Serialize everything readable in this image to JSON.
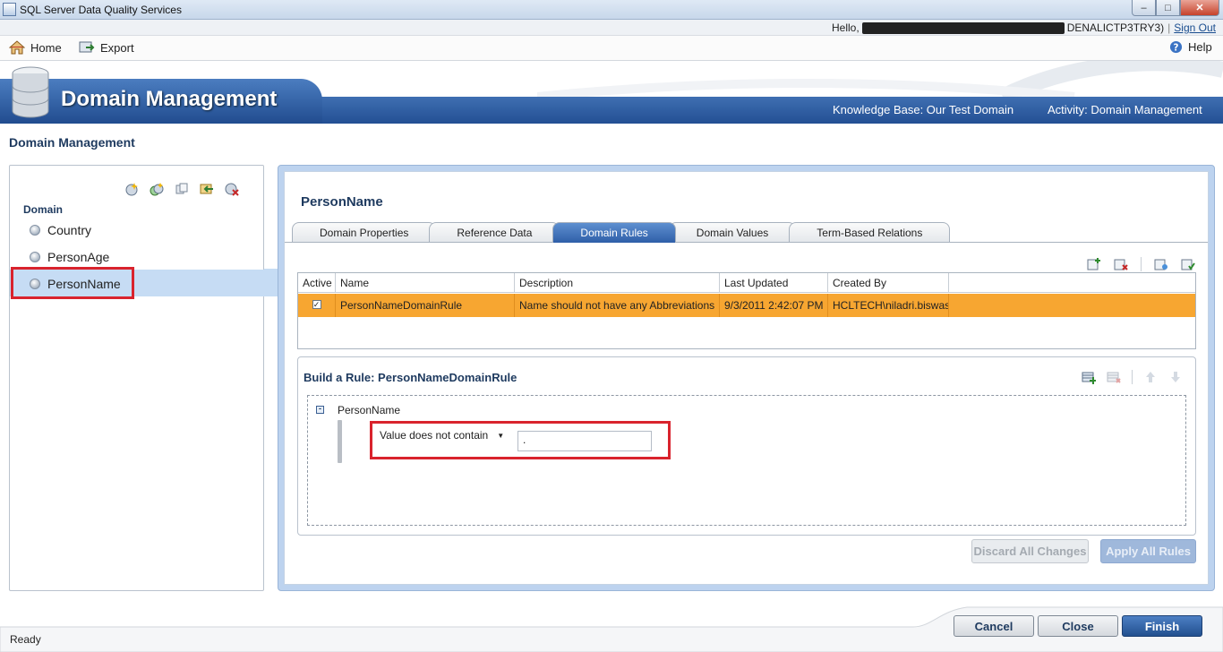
{
  "window": {
    "title": "SQL Server Data Quality Services",
    "buttons": {
      "minimize": "–",
      "maximize": "□",
      "close": "✕"
    }
  },
  "user_bar": {
    "hello": "Hello,",
    "account_suffix": "DENALICTP3TRY3)",
    "separator": "|",
    "sign_out": "Sign Out"
  },
  "toolbar": {
    "home": "Home",
    "export": "Export",
    "help": "Help"
  },
  "banner": {
    "heading": "Domain Management",
    "knowledge_base": "Knowledge Base: Our Test Domain",
    "activity": "Activity: Domain Management"
  },
  "page_title": "Domain Management",
  "domain_list": {
    "header": "Domain",
    "items": [
      {
        "label": "Country"
      },
      {
        "label": "PersonAge"
      },
      {
        "label": "PersonName"
      }
    ],
    "selected": "PersonName"
  },
  "detail": {
    "title": "PersonName",
    "tabs": [
      {
        "label": "Domain Properties"
      },
      {
        "label": "Reference Data"
      },
      {
        "label": "Domain Rules"
      },
      {
        "label": "Domain Values"
      },
      {
        "label": "Term-Based Relations"
      }
    ],
    "active_tab": "Domain Rules",
    "grid": {
      "columns": [
        "Active",
        "Name",
        "Description",
        "Last Updated",
        "Created By"
      ],
      "rows": [
        {
          "active": "✓",
          "name": "PersonNameDomainRule",
          "description": "Name should not have any Abbreviations",
          "last_updated": "9/3/2011 2:42:07 PM",
          "created_by": "HCLTECH\\niladri.biswas"
        }
      ]
    },
    "builder": {
      "title": "Build a Rule: PersonNameDomainRule",
      "node": "PersonName",
      "condition": "Value does not contain",
      "value": "."
    },
    "buttons": {
      "discard": "Discard All Changes",
      "apply": "Apply All Rules"
    }
  },
  "footer": {
    "cancel": "Cancel",
    "close": "Close",
    "finish": "Finish",
    "status": "Ready"
  },
  "colors": {
    "banner_blue": "#2b5aa0",
    "selection": "#c6dcf4",
    "row_highlight": "#f7a631",
    "callout_red": "#d9232d"
  }
}
